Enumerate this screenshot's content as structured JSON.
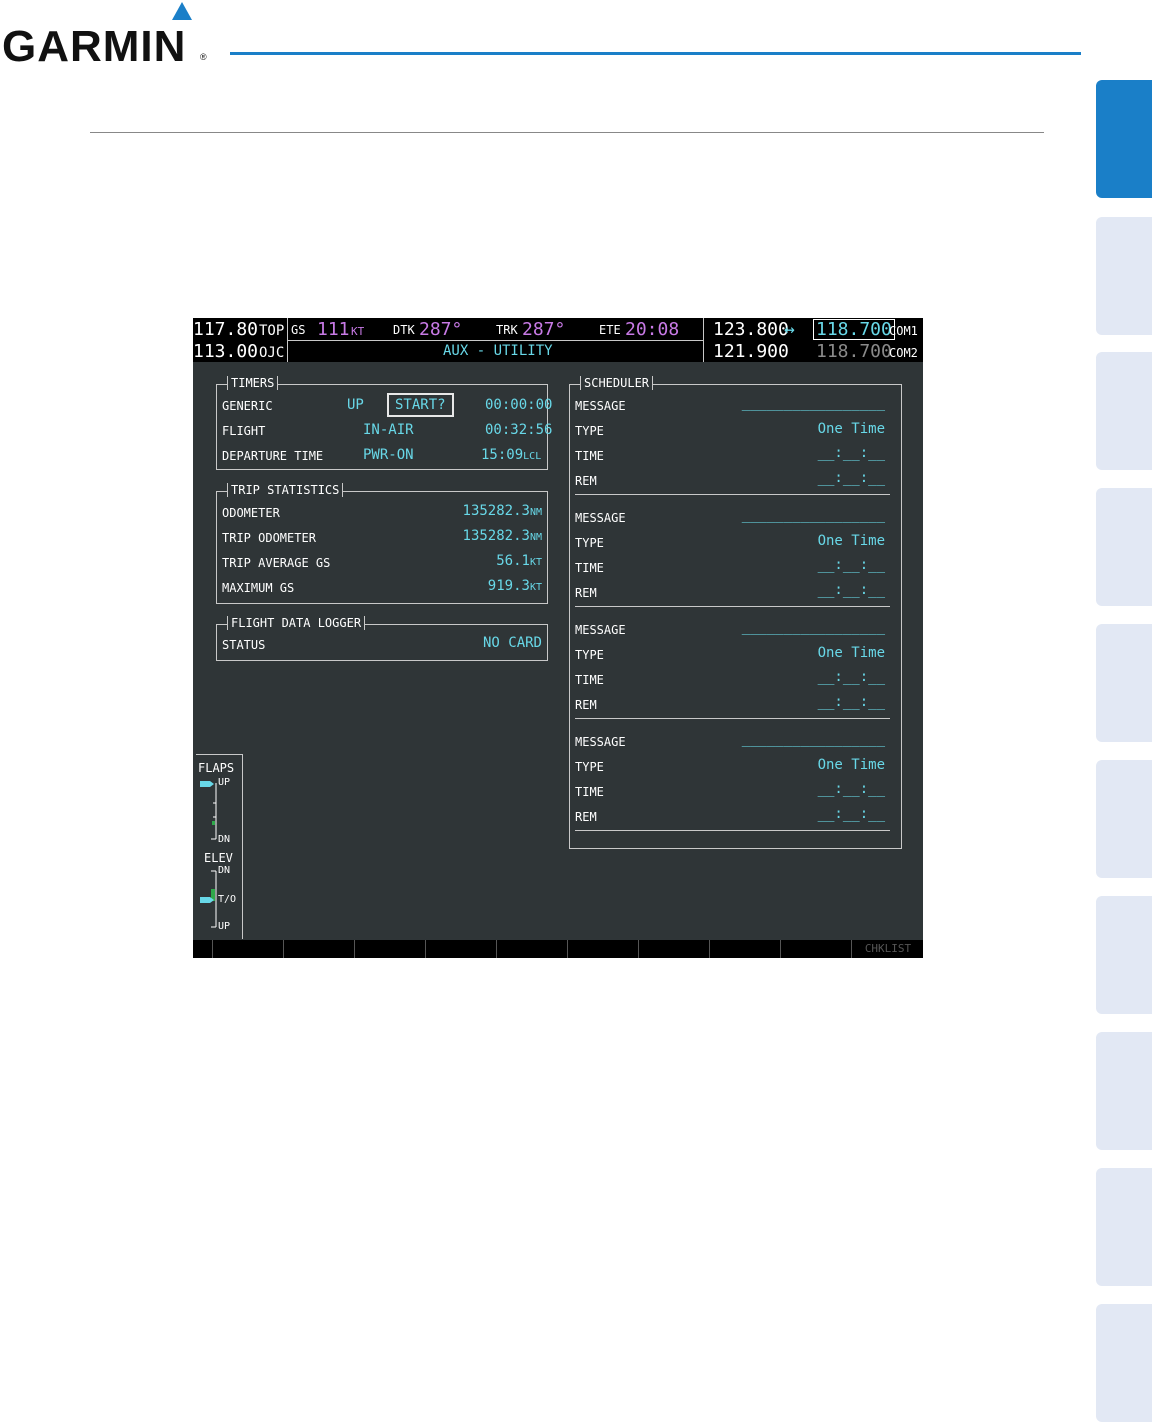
{
  "header": {
    "logo_text": "GARMIN",
    "logo_reg": "®",
    "accent_color": "#1a7fc8"
  },
  "topbar": {
    "nav1_active": "117.80",
    "nav1_ident": "TOP",
    "nav2_standby": "113.00",
    "nav2_ident": "OJC",
    "gs_label": "GS",
    "gs_value": "111",
    "gs_unit": "KT",
    "dtk_label": "DTK",
    "dtk_value": "287°",
    "trk_label": "TRK",
    "trk_value": "287°",
    "ete_label": "ETE",
    "ete_value": "20:08",
    "page_title": "AUX - UTILITY",
    "com1_active": "123.800",
    "swap_arrow": "↔",
    "com1_standby": "118.700",
    "com1_label": "COM1",
    "com2_active": "121.900",
    "com2_standby": "118.700",
    "com2_label": "COM2"
  },
  "timers": {
    "title": "TIMERS",
    "rows": [
      {
        "label": "GENERIC",
        "mode": "UP",
        "button": "START?",
        "value": "00:00:00"
      },
      {
        "label": "FLIGHT",
        "mode": "IN-AIR",
        "value": "00:32:56"
      },
      {
        "label": "DEPARTURE TIME",
        "mode": "PWR-ON",
        "value": "15:09",
        "unit": "LCL"
      }
    ]
  },
  "trip": {
    "title": "TRIP STATISTICS",
    "rows": [
      {
        "label": "ODOMETER",
        "value": "135282.3",
        "unit": "NM"
      },
      {
        "label": "TRIP ODOMETER",
        "value": "135282.3",
        "unit": "NM"
      },
      {
        "label": "TRIP AVERAGE GS",
        "value": "56.1",
        "unit": "KT"
      },
      {
        "label": "MAXIMUM GS",
        "value": "919.3",
        "unit": "KT"
      }
    ]
  },
  "logger": {
    "title": "FLIGHT DATA LOGGER",
    "label": "STATUS",
    "value": "NO CARD"
  },
  "scheduler": {
    "title": "SCHEDULER",
    "entries": [
      {
        "message_label": "MESSAGE",
        "message_value": "_________________",
        "type_label": "TYPE",
        "type_value": "One Time",
        "time_label": "TIME",
        "time_value": "__:__:__",
        "rem_label": "REM",
        "rem_value": "__:__:__"
      },
      {
        "message_label": "MESSAGE",
        "message_value": "_________________",
        "type_label": "TYPE",
        "type_value": "One Time",
        "time_label": "TIME",
        "time_value": "__:__:__",
        "rem_label": "REM",
        "rem_value": "__:__:__"
      },
      {
        "message_label": "MESSAGE",
        "message_value": "_________________",
        "type_label": "TYPE",
        "type_value": "One Time",
        "time_label": "TIME",
        "time_value": "__:__:__",
        "rem_label": "REM",
        "rem_value": "__:__:__"
      },
      {
        "message_label": "MESSAGE",
        "message_value": "_________________",
        "type_label": "TYPE",
        "type_value": "One Time",
        "time_label": "TIME",
        "time_value": "__:__:__",
        "rem_label": "REM",
        "rem_value": "__:__:__"
      }
    ]
  },
  "flaps": {
    "title": "FLAPS",
    "up": "UP",
    "dn": "DN"
  },
  "elev": {
    "title": "ELEV",
    "dn": "DN",
    "to": "T/O",
    "up": "UP"
  },
  "softkeys": {
    "last_label": "CHKLIST"
  }
}
